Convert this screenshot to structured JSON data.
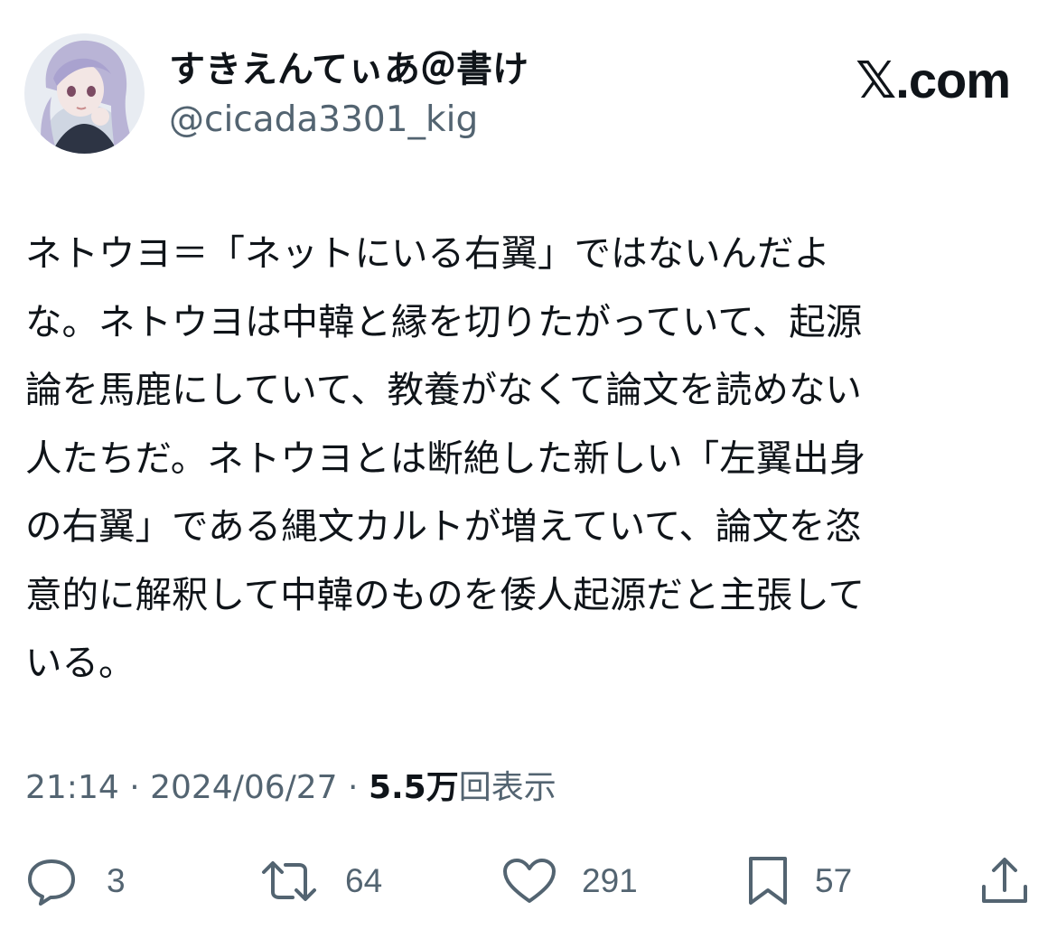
{
  "author": {
    "display_name": "すきえんてぃあ＠書け",
    "handle": "@cicada3301_kig"
  },
  "brand": "𝕏.com",
  "tweet": {
    "text": "ネトウヨ＝「ネットにいる右翼」ではないんだよ\nな。ネトウヨは中韓と縁を切りたがっていて、起源\n論を馬鹿にしていて、教養がなくて論文を読めない\n人たちだ。ネトウヨとは断絶した新しい「左翼出身\nの右翼」である縄文カルトが増えていて、論文を恣\n意的に解釈して中韓のものを倭人起源だと主張して\nいる。"
  },
  "meta": {
    "time": "21:14",
    "separator": " · ",
    "date": "2024/06/27",
    "views_count": "5.5万",
    "views_label": "回表示"
  },
  "actions": {
    "reply_icon": "reply-icon",
    "reply_count": "3",
    "repost_icon": "repost-icon",
    "repost_count": "64",
    "like_icon": "heart-icon",
    "like_count": "291",
    "bookmark_icon": "bookmark-icon",
    "bookmark_count": "57",
    "share_icon": "share-icon"
  },
  "colors": {
    "text_primary": "#0f1419",
    "text_secondary": "#536471",
    "background": "#ffffff"
  }
}
